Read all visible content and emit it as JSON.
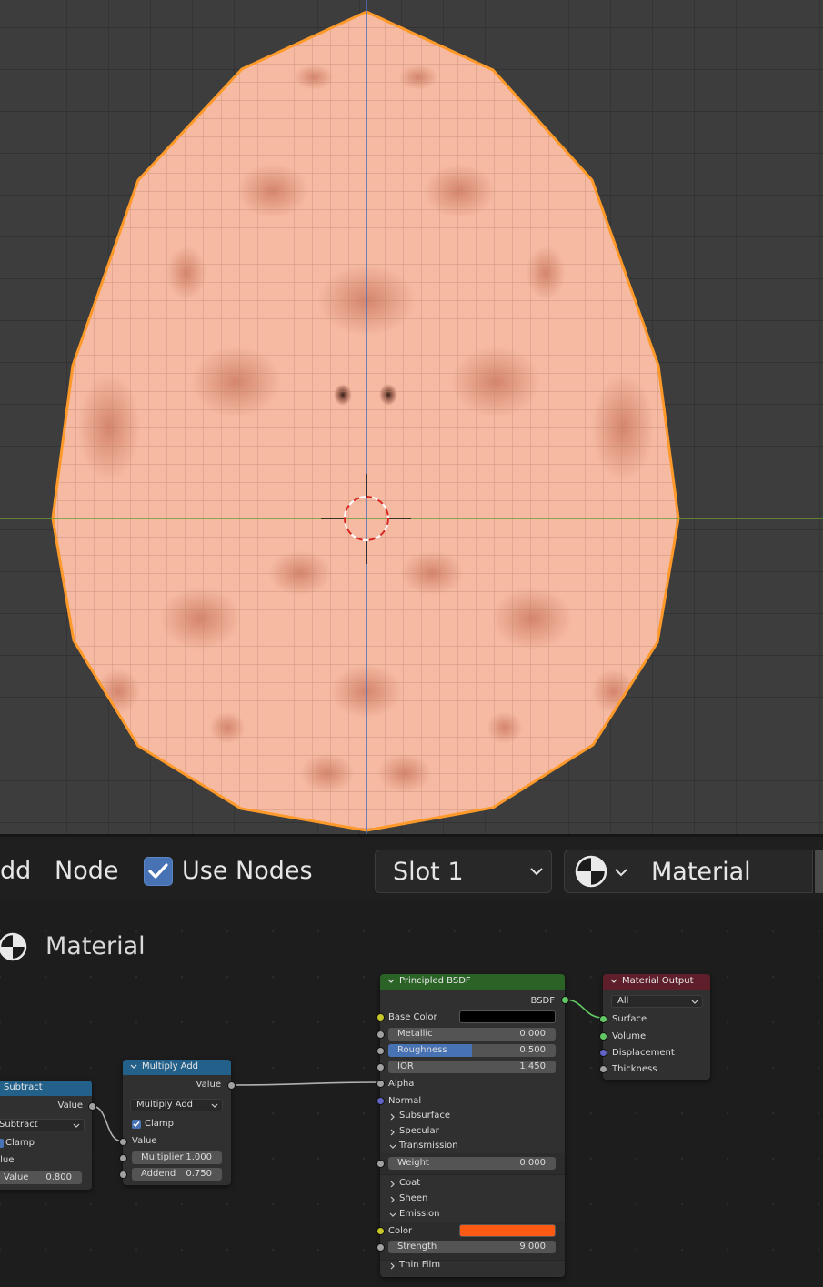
{
  "header": {
    "menu_add": "dd",
    "menu_node": "Node",
    "use_nodes_label": "Use Nodes",
    "use_nodes_checked": true,
    "slot": "Slot 1",
    "material_name": "Material"
  },
  "editor": {
    "title": "Material"
  },
  "nodes": {
    "subtract": {
      "title": "Subtract",
      "output": "Value",
      "operation": "Subtract",
      "clamp": "Clamp",
      "input_value": "alue",
      "value_label": "Value",
      "value": "0.800"
    },
    "multiply_add": {
      "title": "Multiply Add",
      "output": "Value",
      "operation": "Multiply Add",
      "clamp": "Clamp",
      "input_value": "Value",
      "multiplier_label": "Multiplier",
      "multiplier": "1.000",
      "addend_label": "Addend",
      "addend": "0.750"
    },
    "principled": {
      "title": "Principled BSDF",
      "output": "BSDF",
      "base_color": "Base Color",
      "base_color_value": "#000000",
      "metallic_label": "Metallic",
      "metallic": "0.000",
      "roughness_label": "Roughness",
      "roughness": "0.500",
      "ior_label": "IOR",
      "ior": "1.450",
      "alpha": "Alpha",
      "normal": "Normal",
      "subsurface": "Subsurface",
      "specular": "Specular",
      "transmission": "Transmission",
      "weight_label": "Weight",
      "weight": "0.000",
      "coat": "Coat",
      "sheen": "Sheen",
      "emission": "Emission",
      "color_label": "Color",
      "emission_color": "#ff5a14",
      "strength_label": "Strength",
      "strength": "9.000",
      "thin_film": "Thin Film"
    },
    "output": {
      "title": "Material Output",
      "target": "All",
      "surface": "Surface",
      "volume": "Volume",
      "displacement": "Displacement",
      "thickness": "Thickness"
    }
  },
  "colors": {
    "shader_header": "#2b6327",
    "converter_header": "#24618a",
    "output_header": "#5e1e2a",
    "mesh_fill": "#f7bca4",
    "mesh_outline": "#ff9a2a",
    "accent_blue": "#4772b3"
  }
}
